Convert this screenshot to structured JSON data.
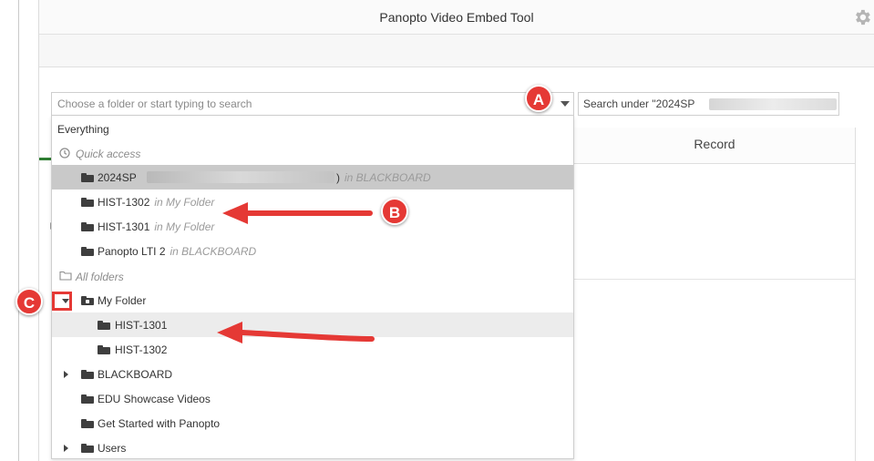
{
  "window": {
    "title": "Panopto Video Embed Tool",
    "settings_icon": "gear-icon"
  },
  "search": {
    "placeholder": "Choose a folder or start typing to search",
    "scope_prefix": "Search under \"2024SP"
  },
  "record_tab": {
    "label": "Record"
  },
  "dropdown": {
    "everything": "Everything",
    "quick_access_label": "Quick access",
    "all_folders_label": "All folders",
    "quick_access": [
      {
        "name": "2024SP",
        "suffix": ")",
        "location": "in BLACKBOARD",
        "selected": true
      },
      {
        "name": "HIST-1302",
        "location": "in My Folder"
      },
      {
        "name": "HIST-1301",
        "location": "in My Folder"
      },
      {
        "name": "Panopto LTI 2",
        "location": "in BLACKBOARD"
      }
    ],
    "folders": [
      {
        "name": "My Folder",
        "expanded": true,
        "children": [
          {
            "name": "HIST-1301",
            "highlighted": true
          },
          {
            "name": "HIST-1302"
          }
        ]
      },
      {
        "name": "BLACKBOARD",
        "expanded": false
      },
      {
        "name": "EDU Showcase Videos"
      },
      {
        "name": "Get Started with Panopto"
      },
      {
        "name": "Users",
        "expanded": false
      }
    ]
  },
  "callouts": {
    "a": "A",
    "b": "B",
    "c": "C"
  },
  "colors": {
    "callout": "#e53935",
    "selected_row": "#c9c9c9",
    "highlight_row": "#ececec"
  }
}
